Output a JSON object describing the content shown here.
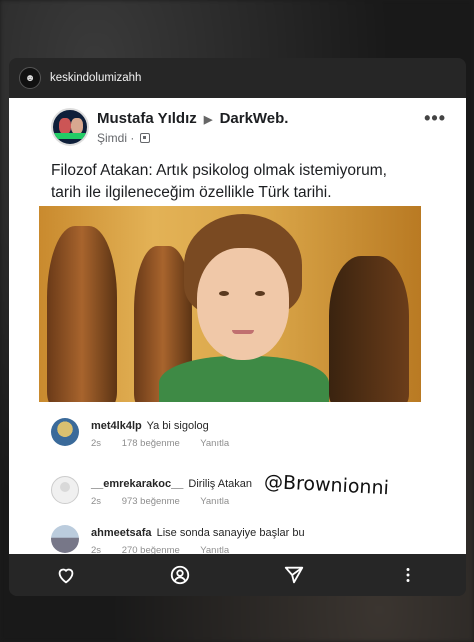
{
  "card": {
    "username": "keskindolumizahh"
  },
  "post": {
    "author": "Mustafa Yıldız",
    "arrow": "▶",
    "group": "DarkWeb.",
    "time": "Şimdi",
    "dot": "·",
    "more": "•••",
    "text_line1": "Filozof Atakan: Artık psikolog olmak istemiyorum,",
    "text_line2": "tarih ile ilgileneceğim özellikle Türk tarihi."
  },
  "comments": [
    {
      "user": "met4lk4lp",
      "text": "Ya bi sigolog",
      "age": "2s",
      "likes": "178 beğenme",
      "reply": "Yanıtla"
    },
    {
      "user": "__emrekarakoc__",
      "text": "Diriliş Atakan",
      "age": "2s",
      "likes": "973 beğenme",
      "reply": "Yanıtla"
    },
    {
      "user": "ahmeetsafa",
      "text": "Lise sonda sanayiye başlar bu",
      "age": "2s",
      "likes": "270 beğenme",
      "reply": "Yanıtla"
    }
  ],
  "watermark": "@Brownionni",
  "footer": {
    "icons": [
      "heart-icon",
      "profile-icon",
      "send-icon",
      "more-vertical-icon"
    ]
  },
  "colors": {
    "card_bg": "#262626",
    "post_bg": "#ffffff",
    "meta_gray": "#8e8e8e"
  }
}
